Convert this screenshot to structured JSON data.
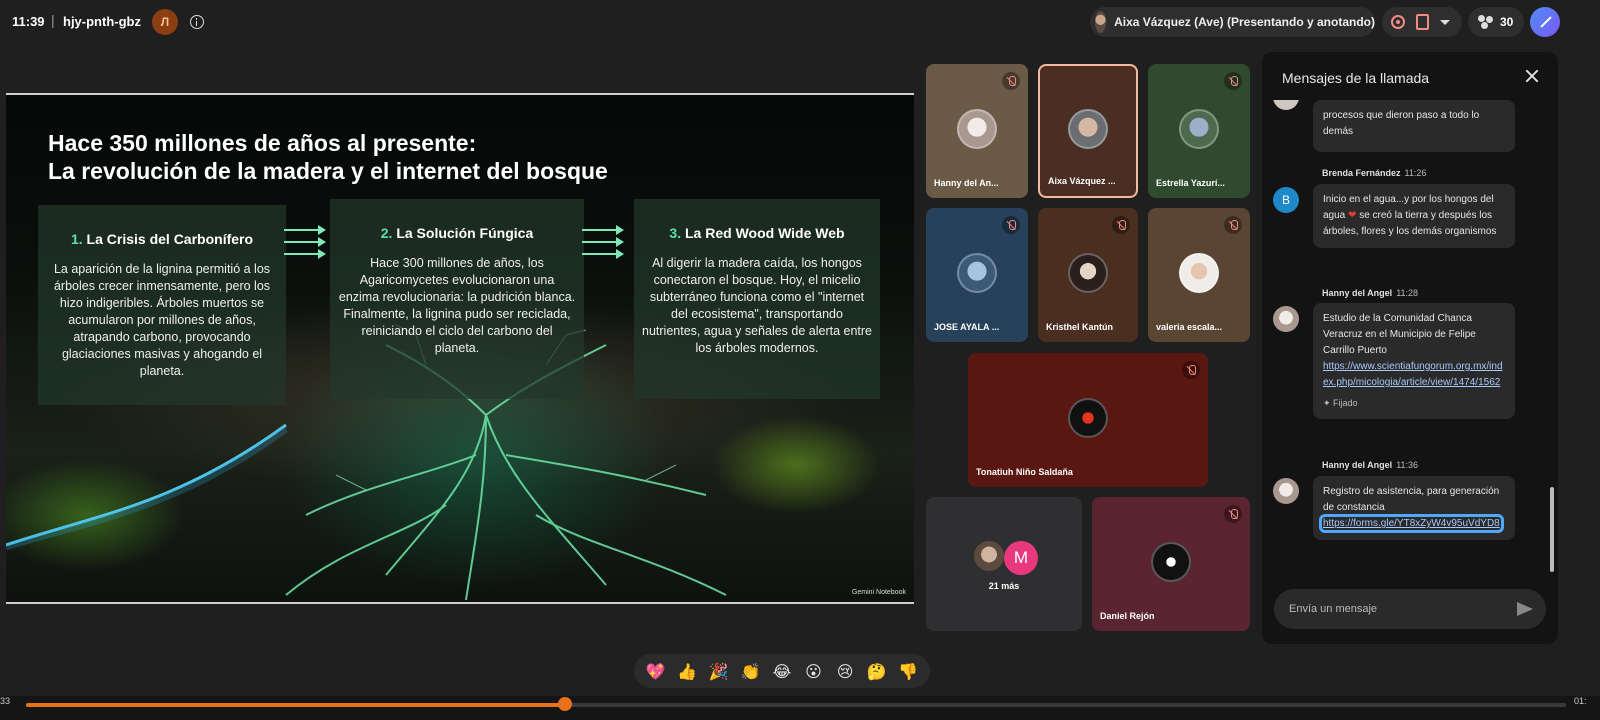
{
  "topbar": {
    "clock": "11:39",
    "separator": "|",
    "meeting_code": "hjy-pnth-gbz",
    "host_badge": "Л",
    "presenter_label": "Aixa Vázquez (Ave) (Presentando y anotando)",
    "participant_count": "30"
  },
  "slide": {
    "title_line1": "Hace 350 millones de años al presente:",
    "title_line2": "La revolución de la madera y el internet del bosque",
    "panels": [
      {
        "number": "1.",
        "heading": "La Crisis del Carbonífero",
        "body": "La aparición de la lignina permitió a los árboles crecer inmensamente, pero los hizo indigeribles. Árboles muertos se acumularon por millones de años, atrapando carbono, provocando glaciaciones masivas y ahogando el planeta."
      },
      {
        "number": "2.",
        "heading": "La Solución Fúngica",
        "body": "Hace 300 millones de años, los Agaricomycetes evolucionaron una enzima revolucionaria: la pudrición blanca. Finalmente, la lignina pudo ser reciclada, reiniciando el ciclo del carbono del planeta."
      },
      {
        "number": "3.",
        "heading": "La Red Wood Wide Web",
        "body": "Al digerir la madera caída, los hongos conectaron el bosque. Hoy, el micelio subterráneo funciona como el \"internet del ecosistema\", transportando nutrientes, agua y señales de alerta entre los árboles modernos."
      }
    ],
    "credit": "Gemini Notebook"
  },
  "participants": [
    {
      "name": "Hanny del An...",
      "bg": "#6b5a45"
    },
    {
      "name": "Aixa Vázquez ...",
      "bg": "#4a2e22",
      "active": true
    },
    {
      "name": "Estrella Yazurí...",
      "bg": "#2f4a2f"
    },
    {
      "name": "JOSE AYALA ...",
      "bg": "#27415a"
    },
    {
      "name": "Kristhel Kantún",
      "bg": "#4a2e20"
    },
    {
      "name": "valeria escala...",
      "bg": "#5a4532"
    },
    {
      "name": "Tonatiuh Niño Saldaña",
      "bg": "#5a1610"
    },
    {
      "name": "21 más",
      "bg": "#2f2f31",
      "extra_initial": "M"
    },
    {
      "name": "Daniel Rejón",
      "bg": "#5a2530"
    }
  ],
  "chat": {
    "title": "Mensajes de la llamada",
    "messages": [
      {
        "text": "procesos que dieron paso a todo lo demás"
      },
      {
        "sender": "Brenda Fernández",
        "time": "11:26",
        "initial": "B",
        "text_before": "Inicio en el agua...y por los hongos del agua",
        "emoji": "❤",
        "text_after": "se creó la tierra y después los árboles, flores y los demás organismos"
      },
      {
        "sender": "Hanny del Angel",
        "time": "11:28",
        "text": "Estudio de la Comunidad Chanca Veracruz en el Municipio de Felipe Carrillo Puerto",
        "link": "https://www.scientiafungorum.org.mx/index.php/micologia/article/view/1474/1562",
        "pinned": "Fijado"
      },
      {
        "sender": "Hanny del Angel",
        "time": "11:36",
        "text": "Registro de asistencia, para generación de constancia",
        "link": "https://forms.gle/YT8xZyW4v95uVdYD8"
      }
    ],
    "input_placeholder": "Envía un mensaje"
  },
  "reactions": [
    "💖",
    "👍",
    "🎉",
    "👏",
    "😂",
    "😮",
    "😢",
    "🤔",
    "👎"
  ],
  "timeline": {
    "start_label": "33",
    "end_label": "01:",
    "progress": 0.35
  }
}
